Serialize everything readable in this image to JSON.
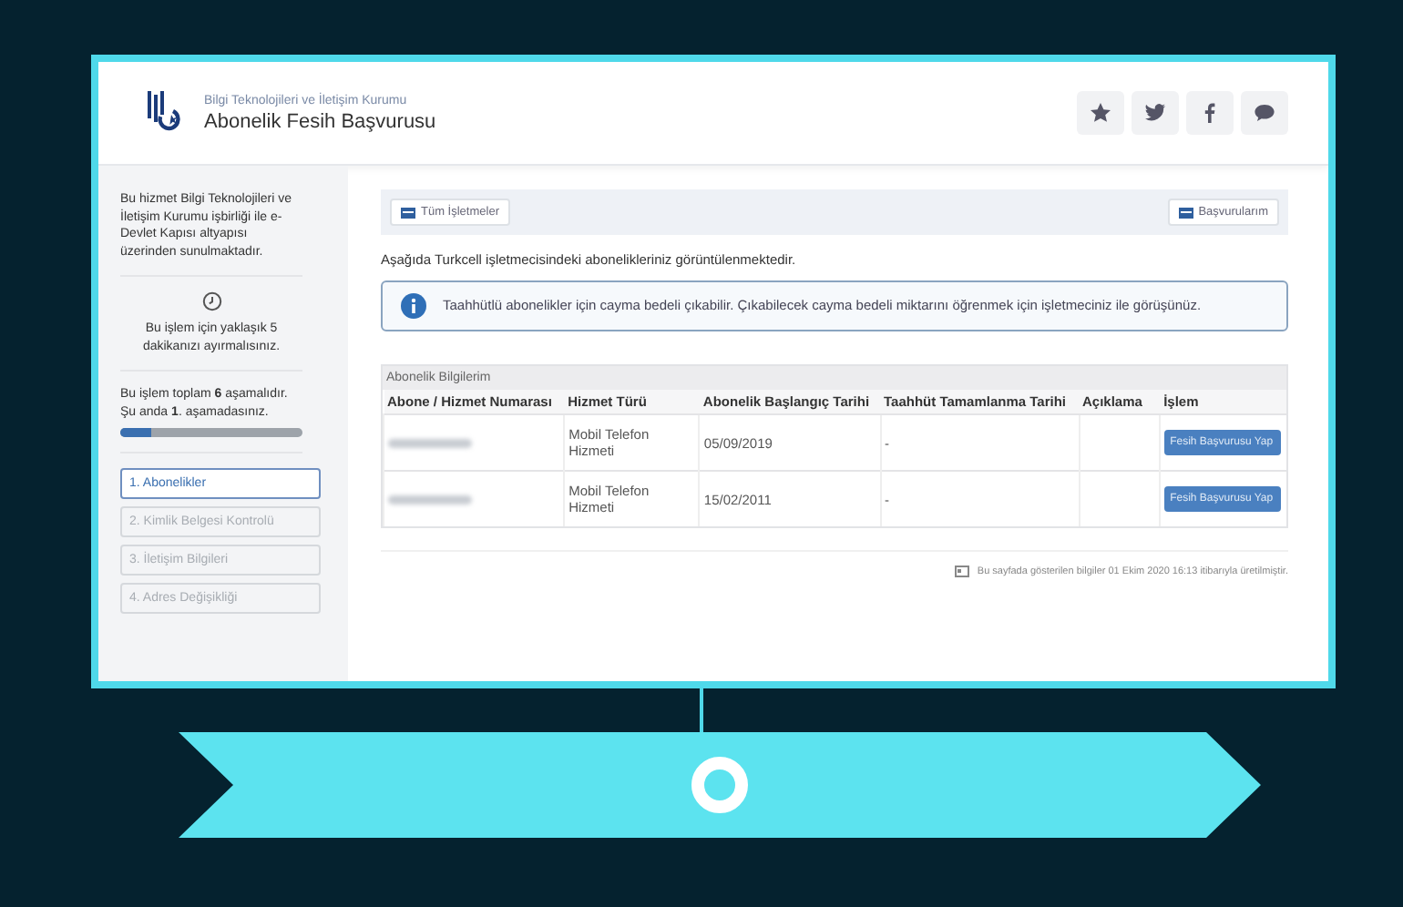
{
  "header": {
    "org": "Bilgi Teknolojileri ve İletişim Kurumu",
    "title": "Abonelik Fesih Başvurusu",
    "actions": [
      {
        "kind": "star"
      },
      {
        "kind": "twitter"
      },
      {
        "kind": "facebook"
      },
      {
        "kind": "chat"
      }
    ]
  },
  "sidebar": {
    "intro": "Bu hizmet Bilgi Teknolojileri ve İletişim Kurumu işbirliği ile e-Devlet Kapısı altyapısı üzerinden sunulmaktadır.",
    "duration": "Bu işlem için yaklaşık 5 dakikanızı ayırmalısınız.",
    "progress_text": "Bu işlem toplam **6** aşamalıdır. Şu anda **1**. aşamadasınız.",
    "progress": {
      "level": 0.17
    },
    "steps": [
      {
        "label": "1. Abonelikler",
        "selected": true
      },
      {
        "label": "2. Kimlik Belgesi Kontrolü",
        "selected": false
      },
      {
        "label": "3. İletişim Bilgileri",
        "selected": false
      },
      {
        "label": "4. Adres Değişikliği",
        "selected": false
      }
    ]
  },
  "toolbar": {
    "left_button": "Tüm İşletmeler",
    "right_button": "Başvurularım"
  },
  "description": "Aşağıda Turkcell işletmecisindeki abonelikleriniz görüntülenmektedir.",
  "alert": "Taahhütlü abonelikler için cayma bedeli çıkabilir. Çıkabilecek cayma bedeli miktarını öğrenmek için işletmeciniz ile görüşünüz.",
  "table": {
    "caption": "Abonelik Bilgilerim",
    "columns": [
      "Abone / Hizmet Numarası",
      "Hizmet Türü",
      "Abonelik Başlangıç Tarihi",
      "Taahhüt Tamamlanma Tarihi",
      "Açıklama",
      "İşlem"
    ],
    "rows": [
      {
        "service": "Mobil Telefon Hizmeti",
        "start": "05/09/2019",
        "end": "-",
        "note": "",
        "action": "Fesih Başvurusu Yap"
      },
      {
        "service": "Mobil Telefon Hizmeti",
        "start": "15/02/2011",
        "end": "-",
        "note": "",
        "action": "Fesih Başvurusu Yap"
      }
    ]
  },
  "footer": "Bu sayfada gösterilen bilgiler 01 Ekim 2020 16:13 itibarıyla üretilmiştir."
}
